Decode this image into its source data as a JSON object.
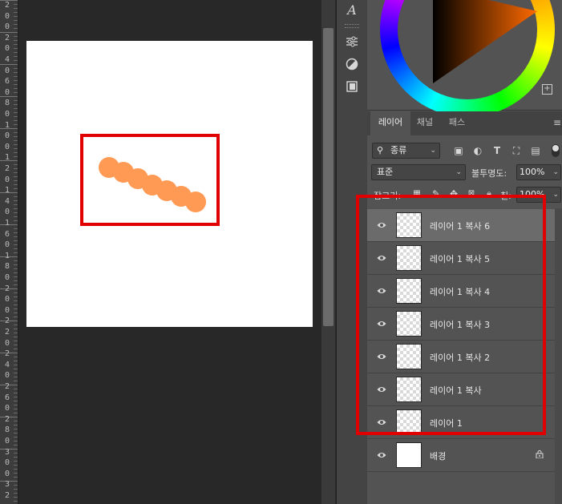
{
  "ruler": {
    "digits": [
      "2",
      "0",
      "0",
      "2",
      "0",
      "4",
      "0",
      "6",
      "0",
      "8",
      "0",
      "1",
      "0",
      "0",
      "1",
      "2",
      "0",
      "1",
      "4",
      "0",
      "1",
      "6",
      "0",
      "1",
      "8",
      "0",
      "2",
      "0",
      "0",
      "2",
      "2",
      "0",
      "2",
      "4",
      "0",
      "2",
      "6",
      "0",
      "2",
      "8",
      "0",
      "3",
      "0",
      "0",
      "3",
      "2"
    ]
  },
  "colors": {
    "highlight": "#e00000",
    "brush": "#ff9a55",
    "panel": "#535353",
    "selected_layer": "#6b6b6b"
  },
  "toolbar": {
    "tools": [
      "type-tool-icon",
      "adjustments-icon",
      "styles-icon",
      "libraries-icon"
    ]
  },
  "panel": {
    "tabs": [
      {
        "label": "레이어",
        "active": true
      },
      {
        "label": "채널"
      },
      {
        "label": "패스"
      }
    ],
    "filter": {
      "kind_label": "종류"
    },
    "blend_mode": "표준",
    "opacity_label": "불투명도:",
    "opacity_value": "100%",
    "lock_label": "잠그기:",
    "fill_label": "칠:",
    "fill_value": "100%"
  },
  "layers": [
    {
      "name": "레이어 1 복사 6",
      "selected": true
    },
    {
      "name": "레이어 1 복사 5"
    },
    {
      "name": "레이어 1 복사 4"
    },
    {
      "name": "레이어 1 복사 3"
    },
    {
      "name": "레이어 1 복사 2"
    },
    {
      "name": "레이어 1 복사"
    },
    {
      "name": "레이어 1"
    },
    {
      "name": "배경",
      "locked": true
    }
  ]
}
